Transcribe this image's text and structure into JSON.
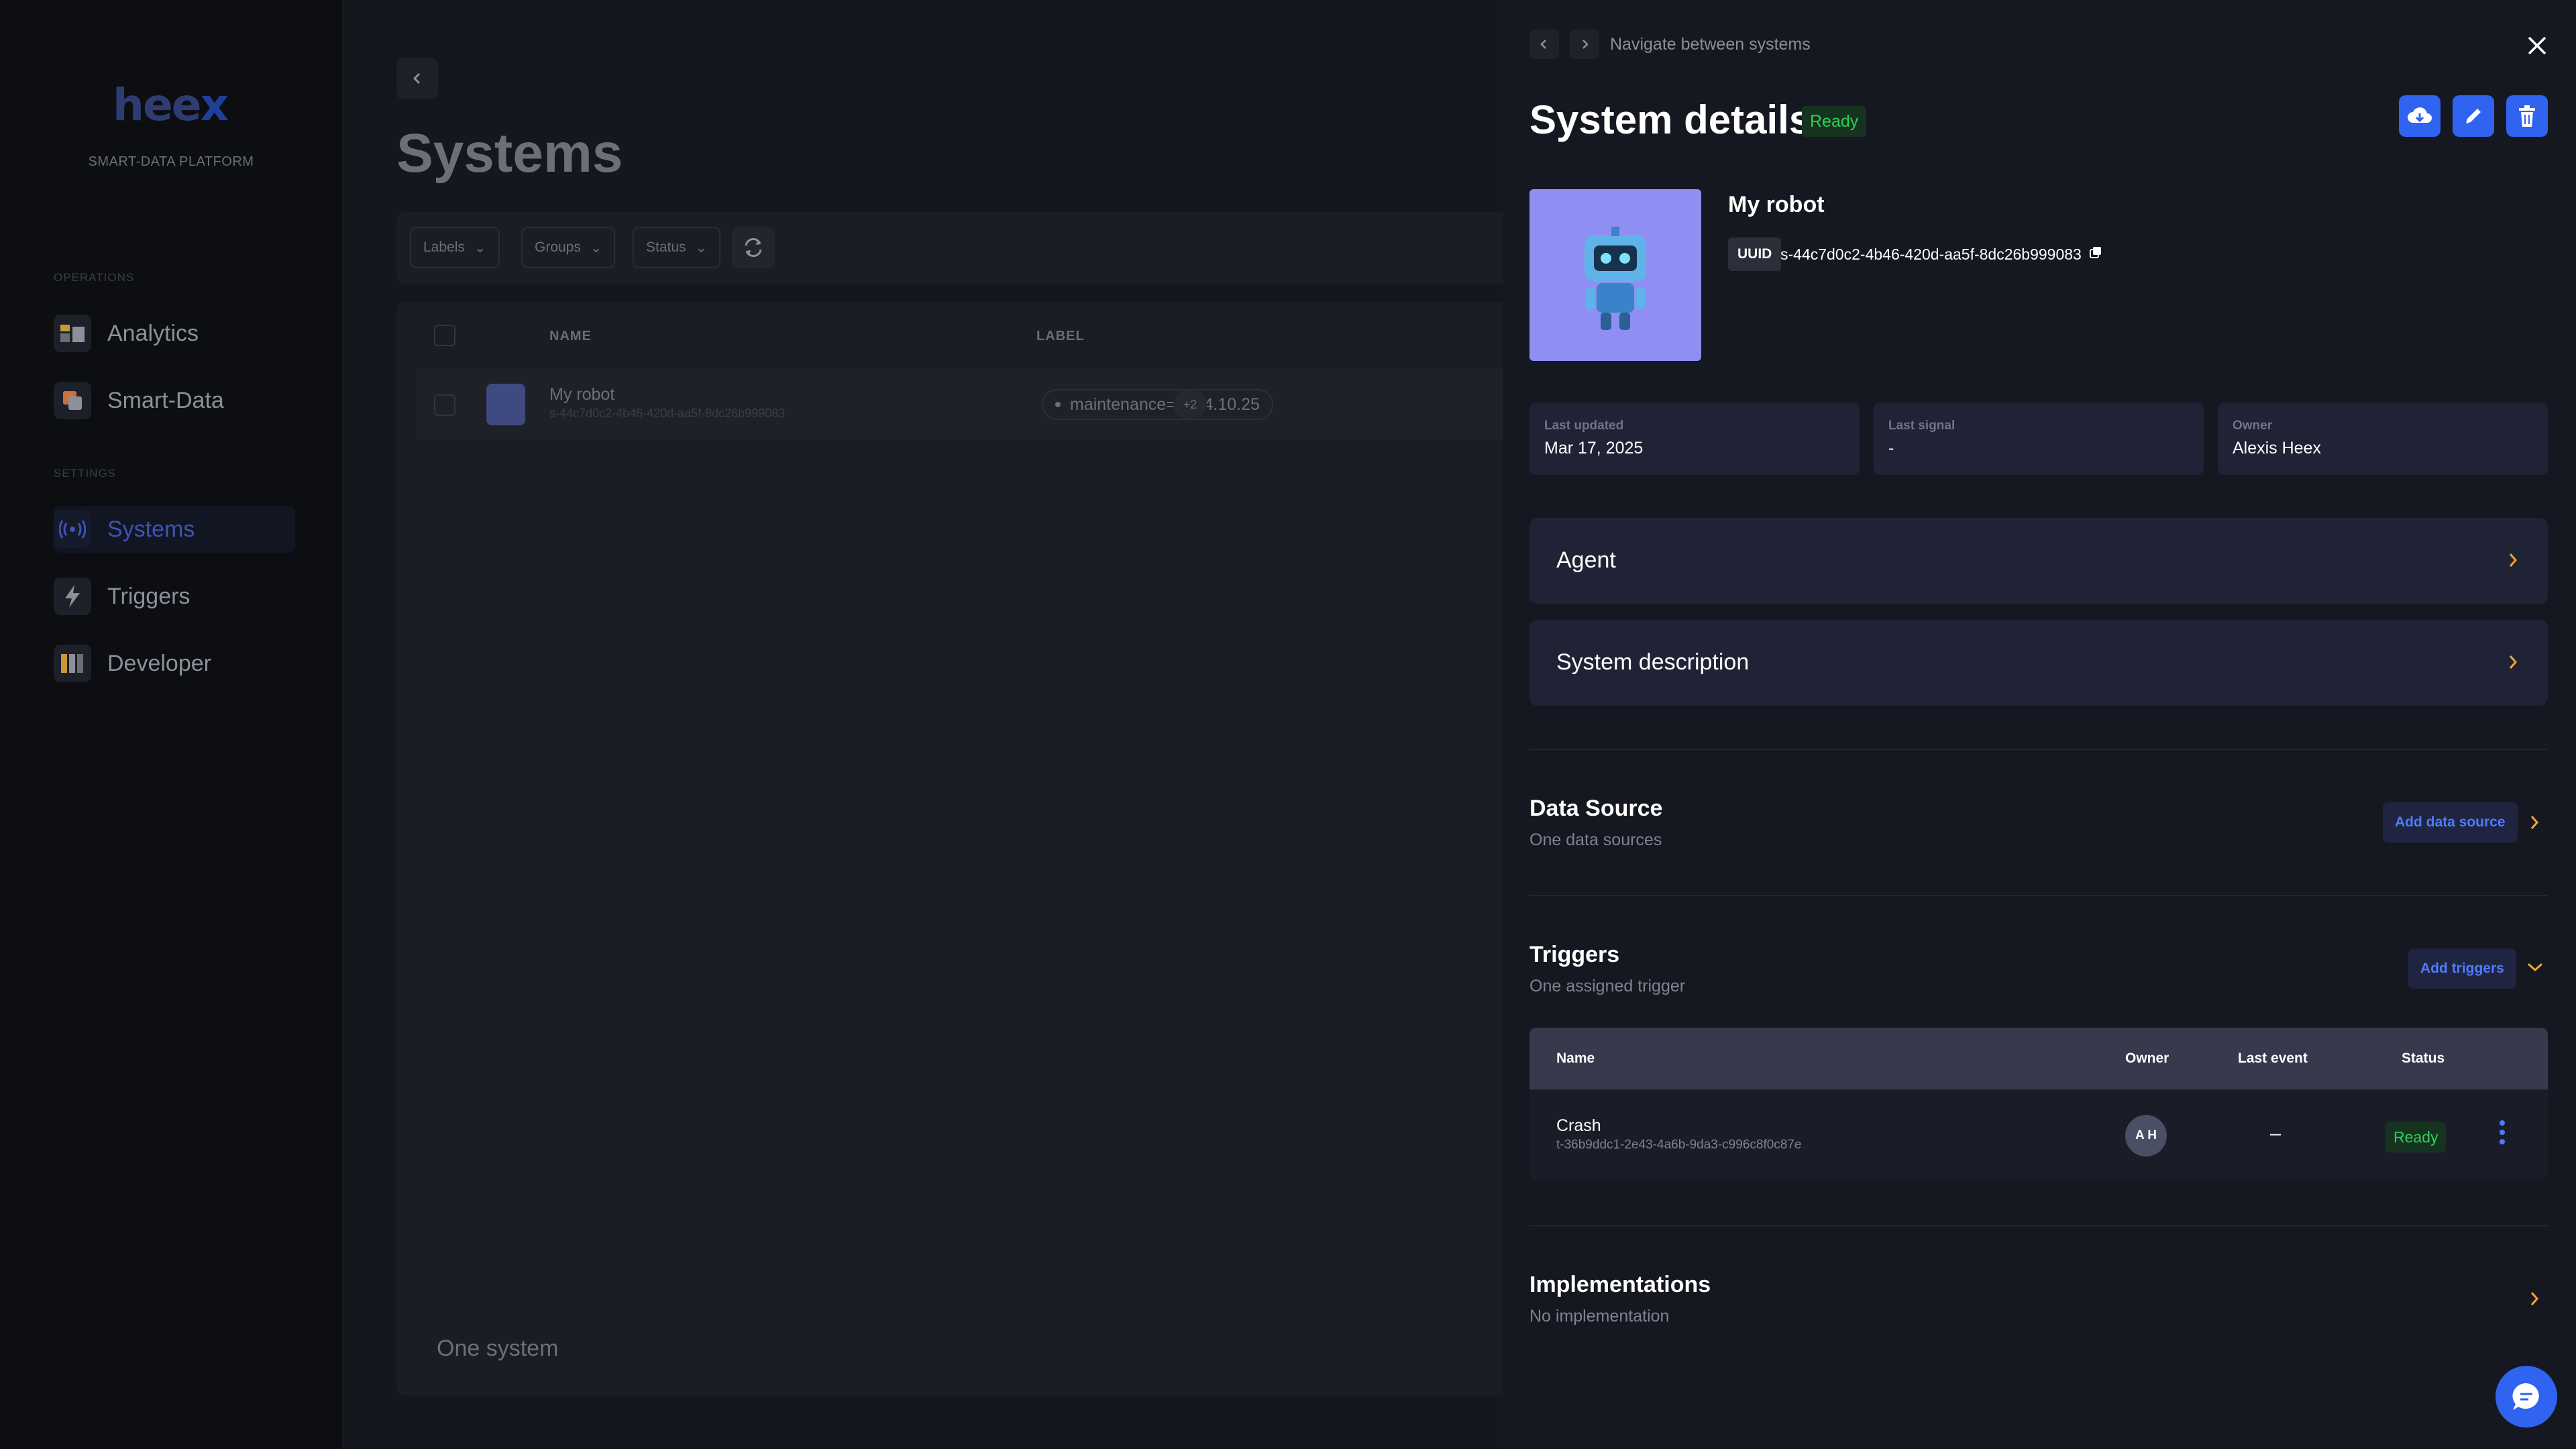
{
  "sidebar": {
    "logo": "hee",
    "logo_x": "x",
    "platform": "SMART-DATA PLATFORM",
    "sections": {
      "operations": "OPERATIONS",
      "settings": "SETTINGS"
    },
    "items": [
      {
        "label": "Analytics",
        "icon": "analytics-icon"
      },
      {
        "label": "Smart-Data",
        "icon": "smart-data-icon"
      },
      {
        "label": "Systems",
        "icon": "antenna-icon",
        "active": true
      },
      {
        "label": "Triggers",
        "icon": "lightning-icon"
      },
      {
        "label": "Developer",
        "icon": "columns-icon"
      }
    ]
  },
  "main": {
    "title": "Systems",
    "filters": [
      "Labels",
      "Groups",
      "Status"
    ],
    "columns": {
      "name": "NAME",
      "label": "LABEL"
    },
    "rows": [
      {
        "name": "My robot",
        "uuid": "s-44c7d0c2-4b46-420d-aa5f-8dc26b999083",
        "label": "maintenance=2024.10.25",
        "more": "+2"
      }
    ],
    "count": "One system"
  },
  "drawer": {
    "nav_hint": "Navigate between systems",
    "title": "System details",
    "status": "Ready",
    "system_name": "My robot",
    "uuid_tag": "UUID",
    "uuid": "s-44c7d0c2-4b46-420d-aa5f-8dc26b999083",
    "meta": [
      {
        "label": "Last updated",
        "value": "Mar 17, 2025"
      },
      {
        "label": "Last signal",
        "value": "-"
      },
      {
        "label": "Owner",
        "value": "Alexis Heex"
      }
    ],
    "accordions": [
      "Agent",
      "System description"
    ],
    "data_source": {
      "title": "Data Source",
      "subtitle": "One data sources",
      "button": "Add data source"
    },
    "triggers": {
      "title": "Triggers",
      "subtitle": "One assigned trigger",
      "button": "Add triggers",
      "columns": {
        "name": "Name",
        "owner": "Owner",
        "last_event": "Last event",
        "status": "Status"
      },
      "rows": [
        {
          "name": "Crash",
          "id": "t-36b9ddc1-2e43-4a6b-9da3-c996c8f0c87e",
          "owner": "A H",
          "last_event": "–",
          "status": "Ready"
        }
      ]
    },
    "implementations": {
      "title": "Implementations",
      "subtitle": "No implementation"
    }
  },
  "colors": {
    "accent": "#2f63f0",
    "ready_green": "#2bd15b",
    "chevron_orange": "#f0a43a"
  }
}
